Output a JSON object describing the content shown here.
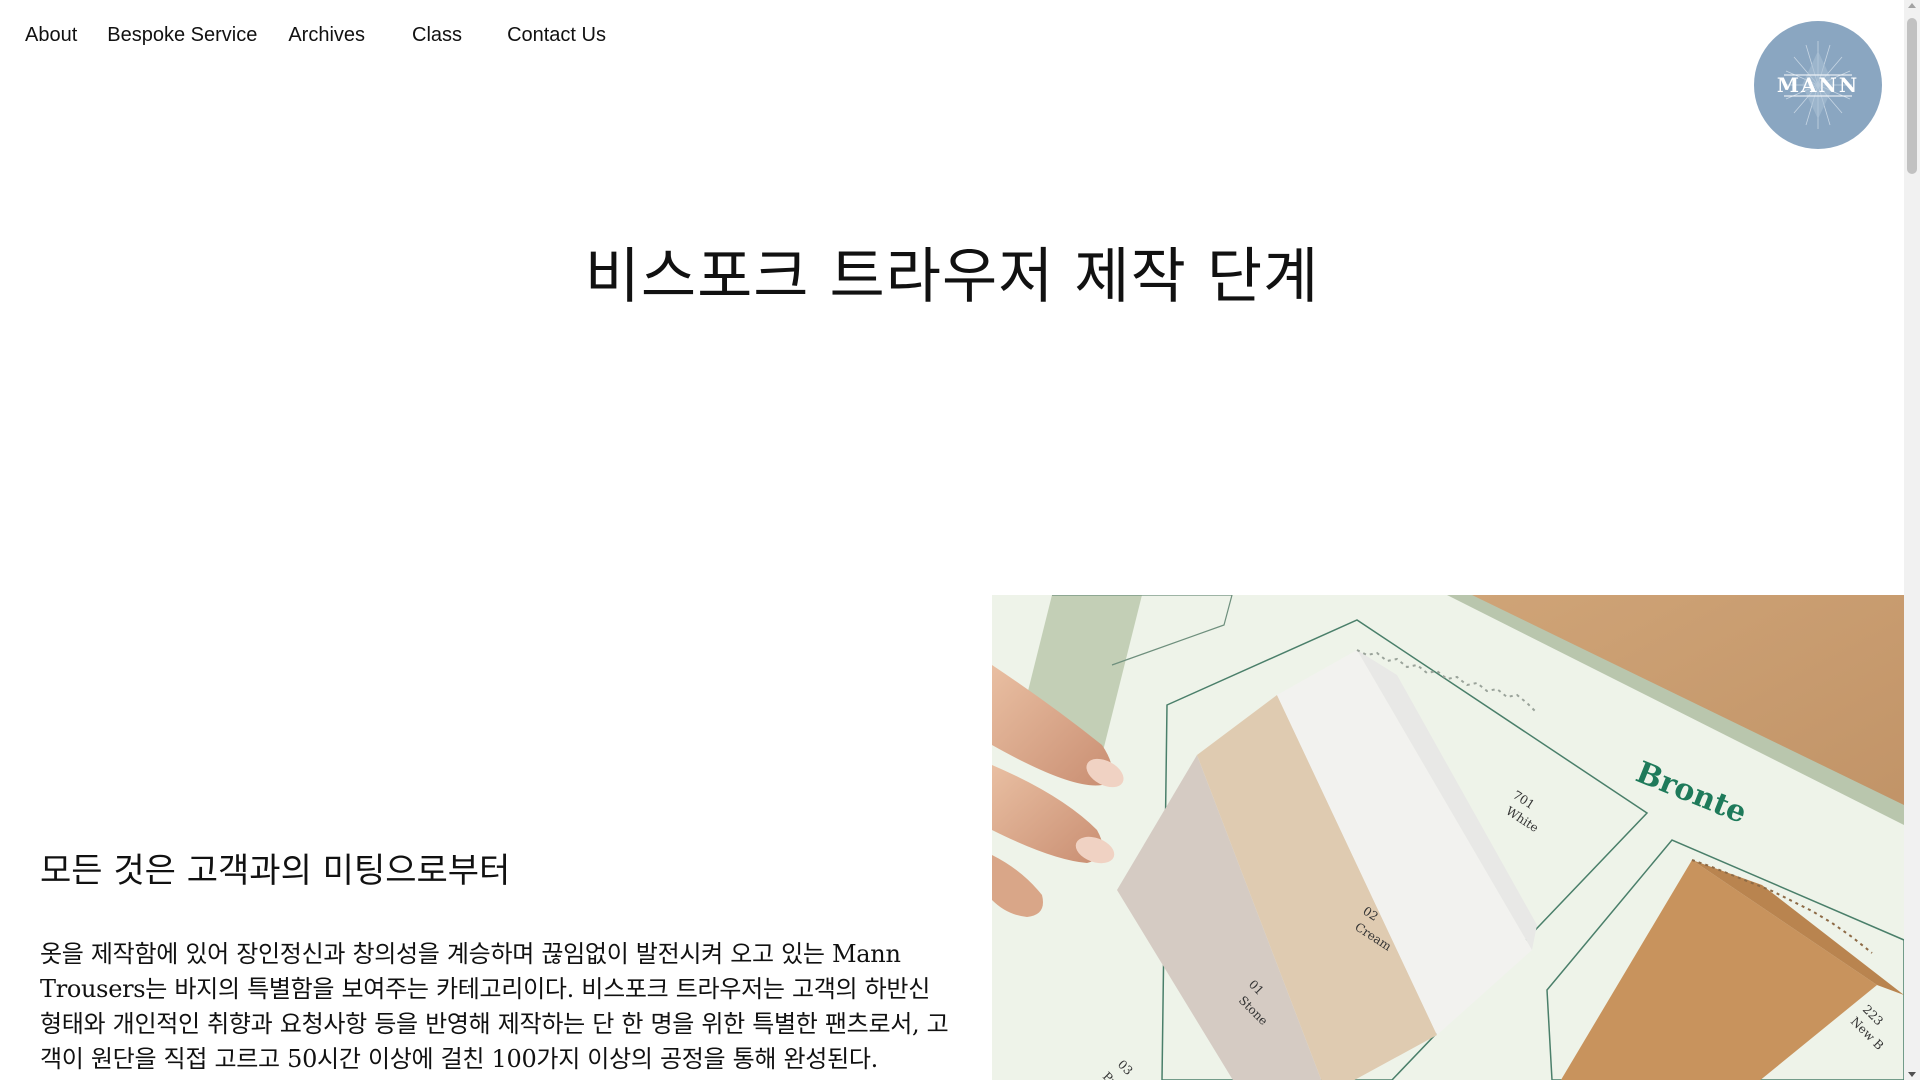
{
  "nav": {
    "items": [
      {
        "label": "About"
      },
      {
        "label": "Bespoke Service"
      },
      {
        "label": "Archives"
      },
      {
        "label": "Class"
      },
      {
        "label": "Contact Us"
      }
    ]
  },
  "logo": {
    "text": "MANN",
    "color": "#8aa6c1"
  },
  "page": {
    "title": "비스포크 트라우저 제작 단계"
  },
  "section": {
    "heading": "모든 것은 고객과의 미팅으로부터",
    "body": "옷을 제작함에 있어 장인정신과 창의성을 계승하며 끊임없이 발전시켜 오고 있는 Mann Trousers는 바지의 특별함을 보여주는 카테고리이다. 비스포크 트라우저는 고객의 하반신 형태와 개인적인 취향과 요청사항 등을 반영해 제작하는 단 한 명을 위한 특별한 팬츠로서, 고객이 원단을 직접 고르고 50시간 이상에 걸친 100가지 이상의 공정을 통해 완성된다."
  },
  "photo": {
    "book_title": "Bronte",
    "swatches": [
      {
        "code": "701",
        "name": "White"
      },
      {
        "code": "02",
        "name": "Cream"
      },
      {
        "code": "01",
        "name": "Stone"
      },
      {
        "code": "03",
        "name": "Pu"
      },
      {
        "code": "223",
        "name": "New B"
      }
    ]
  }
}
